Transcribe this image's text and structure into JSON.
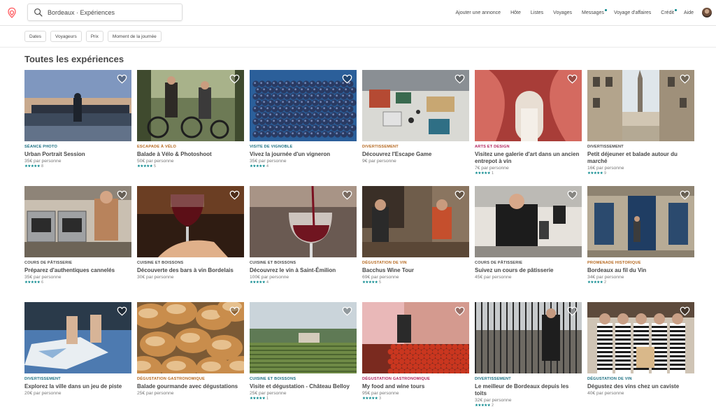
{
  "header": {
    "search_value": "Bordeaux · Expériences",
    "nav": [
      {
        "label": "Ajouter une annonce",
        "dot": false
      },
      {
        "label": "Hôte",
        "dot": false
      },
      {
        "label": "Listes",
        "dot": false
      },
      {
        "label": "Voyages",
        "dot": false
      },
      {
        "label": "Messages",
        "dot": true
      },
      {
        "label": "Voyage d'affaires",
        "dot": false
      },
      {
        "label": "Crédit",
        "dot": true
      },
      {
        "label": "Aide",
        "dot": false
      }
    ]
  },
  "filters": [
    "Dates",
    "Voyageurs",
    "Prix",
    "Moment de la journée"
  ],
  "section_title": "Toutes les expériences",
  "colors": {
    "brand": "#ff5a5f",
    "stars": "#008489"
  },
  "experiences": [
    {
      "category": "Séance photo",
      "cat_color": "#1a6f82",
      "title": "Urban Portrait Session",
      "price": "35€ par personne",
      "reviews": "8",
      "stars": "★★★★★",
      "scene": "dusk"
    },
    {
      "category": "Escapade à vélo",
      "cat_color": "#b5671d",
      "title": "Balade à Vélo & Photoshoot",
      "price": "50€ par personne",
      "reviews": "5",
      "stars": "★★★★★",
      "scene": "bikes"
    },
    {
      "category": "Visite de vignoble",
      "cat_color": "#1a6f82",
      "title": "Vivez la journée d'un vigneron",
      "price": "35€ par personne",
      "reviews": "4",
      "stars": "★★★★★",
      "scene": "grapes"
    },
    {
      "category": "Divertissement",
      "cat_color": "#b5671d",
      "title": "Découvrez l'Escape Game",
      "price": "9€ par personne",
      "reviews": "",
      "stars": "",
      "scene": "game"
    },
    {
      "category": "Arts et design",
      "cat_color": "#b0225c",
      "title": "Visitez une galerie d'art dans un ancien entrepot à vin",
      "price": "7€ par personne",
      "reviews": "1",
      "stars": "★★★★★",
      "scene": "art"
    },
    {
      "category": "Divertissement",
      "cat_color": "#484848",
      "title": "Petit déjeuner et balade autour du marché",
      "price": "16€ par personne",
      "reviews": "9",
      "stars": "★★★★★",
      "scene": "street"
    },
    {
      "category": "Cours de pâtisserie",
      "cat_color": "#484848",
      "title": "Préparez d'authentiques cannelés",
      "price": "35€ par personne",
      "reviews": "6",
      "stars": "★★★★★",
      "scene": "kitchen"
    },
    {
      "category": "Cuisine et boissons",
      "cat_color": "#484848",
      "title": "Découverte des bars à vin Bordelais",
      "price": "30€ par personne",
      "reviews": "",
      "stars": "",
      "scene": "redwine"
    },
    {
      "category": "Cuisine et boissons",
      "cat_color": "#484848",
      "title": "Découvrez le vin à Saint-Émilion",
      "price": "100€ par personne",
      "reviews": "4",
      "stars": "★★★★★",
      "scene": "pour"
    },
    {
      "category": "Dégustation de vin",
      "cat_color": "#b5671d",
      "title": "Bacchus Wine Tour",
      "price": "69€ par personne",
      "reviews": "5",
      "stars": "★★★★★",
      "scene": "bar"
    },
    {
      "category": "Cours de pâtisserie",
      "cat_color": "#484848",
      "title": "Suivez un cours de pâtisserie",
      "price": "45€ par personne",
      "reviews": "",
      "stars": "",
      "scene": "chef"
    },
    {
      "category": "Promenade historique",
      "cat_color": "#b5671d",
      "title": "Bordeaux au fil du Vin",
      "price": "34€ par personne",
      "reviews": "2",
      "stars": "★★★★★",
      "scene": "door"
    },
    {
      "category": "Divertissement",
      "cat_color": "#1a6f82",
      "title": "Explorez la ville dans un jeu de piste",
      "price": "20€ par personne",
      "reviews": "",
      "stars": "",
      "scene": "map"
    },
    {
      "category": "Dégustation gastronomique",
      "cat_color": "#b5671d",
      "title": "Balade gourmande avec dégustations",
      "price": "25€ par personne",
      "reviews": "",
      "stars": "",
      "scene": "bread"
    },
    {
      "category": "Cuisine et boissons",
      "cat_color": "#1a6f82",
      "title": "Visite et dégustation - Château Belloy",
      "price": "25€ par personne",
      "reviews": "1",
      "stars": "★★★★★",
      "scene": "vineyard"
    },
    {
      "category": "Dégustation gastronomique",
      "cat_color": "#b0225c",
      "title": "My food and wine tours",
      "price": "95€ par personne",
      "reviews": "3",
      "stars": "★★★★★",
      "scene": "market"
    },
    {
      "category": "Divertissement",
      "cat_color": "#1a6f82",
      "title": "Le meilleur de Bordeaux depuis les toits",
      "price": "32€ par personne",
      "reviews": "2",
      "stars": "★★★★★",
      "scene": "roof"
    },
    {
      "category": "Dégustation de vin",
      "cat_color": "#1a6f82",
      "title": "Dégustez des vins chez un caviste",
      "price": "40€ par personne",
      "reviews": "",
      "stars": "",
      "scene": "caviste"
    }
  ]
}
